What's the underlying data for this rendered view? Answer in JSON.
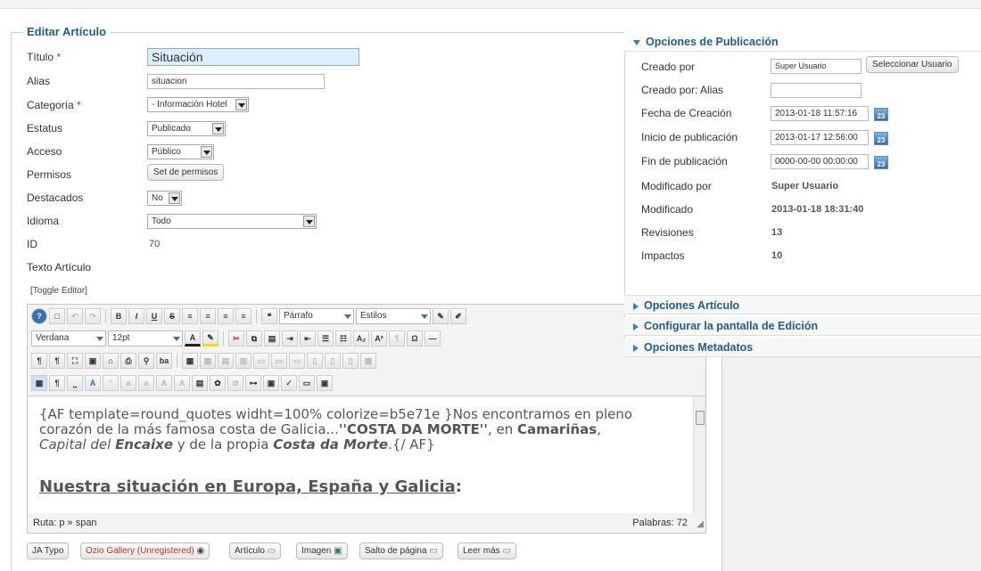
{
  "form": {
    "legend": "Editar Artículo",
    "titulo_label": "Título",
    "titulo_value": "Situación",
    "alias_label": "Alias",
    "alias_value": "situacion",
    "categoria_label": "Categoría",
    "categoria_value": "- Información Hotel",
    "estatus_label": "Estatus",
    "estatus_value": "Publicado",
    "acceso_label": "Acceso",
    "acceso_value": "Público",
    "permisos_label": "Permisos",
    "permisos_button": "Set de permisos",
    "destacados_label": "Destacados",
    "destacados_value": "No",
    "idioma_label": "Idioma",
    "idioma_value": "Todo",
    "id_label": "ID",
    "id_value": "70",
    "texto_label": "Texto Artículo",
    "toggle_editor": "[Toggle Editor]",
    "required_mark": "*"
  },
  "editor": {
    "format_select": "Párrafo",
    "styles_select": "Estilos",
    "font_select": "Verdana",
    "size_select": "12pt",
    "line1": "{AF template=round_quotes widht=100% colorize=b5e71e }Nos encontramos en pleno",
    "line2a": "corazón de la más famosa costa de Galicia...",
    "line2b": "''COSTA DA MORTE''",
    "line2c": ", en ",
    "line2d": "Camariñas",
    "line2e": ",",
    "line3a": "Capital del ",
    "line3b": "Encaixe",
    "line3c": " y de la propia ",
    "line3d": "Costa da Morte",
    "line3e": ".{/ AF}",
    "heading_underlined": "Nuestra situación en Europa, España y Galicia",
    "heading_colon": ":",
    "path": "Ruta:  p » span",
    "words": "Palabras: 72"
  },
  "bottom_buttons": {
    "jatypo": "JA Typo",
    "ozio": "Ozio Gallery (Unregistered)",
    "articulo": "Artículo",
    "imagen": "Imagen",
    "salto": "Salto de página",
    "leer": "Leer más"
  },
  "publishing": {
    "header": "Opciones de Publicación",
    "creado_por_label": "Creado por",
    "creado_por_value": "Super Usuario",
    "select_user_button": "Seleccionar Usuario",
    "creado_alias_label": "Creado por: Alias",
    "fecha_creacion_label": "Fecha de Creación",
    "fecha_creacion_value": "2013-01-18 11:57:16",
    "inicio_label": "Inicio de publicación",
    "inicio_value": "2013-01-17 12:56:00",
    "fin_label": "Fin de publicación",
    "fin_value": "0000-00-00 00:00:00",
    "modificado_por_label": "Modificado por",
    "modificado_por_value": "Super Usuario",
    "modificado_label": "Modificado",
    "modificado_value": "2013-01-18 18:31:40",
    "revisiones_label": "Revisiones",
    "revisiones_value": "13",
    "impactos_label": "Impactos",
    "impactos_value": "10",
    "calendar_glyph": "23"
  },
  "accordion": {
    "articulo": "Opciones Artículo",
    "pantalla": "Configurar la pantalla de Edición",
    "metadatos": "Opciones Metadatos"
  }
}
